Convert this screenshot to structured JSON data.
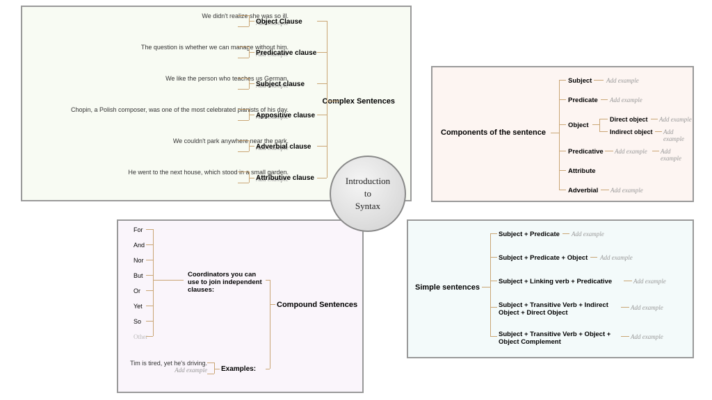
{
  "center": "Introduction\nto\nSyntax",
  "complex": {
    "title": "Complex Sentences",
    "rows": [
      {
        "node": "Object Clause",
        "ex": "We didn't realize she was so ill."
      },
      {
        "node": "Predicative clause",
        "ex": "The question is whether we can manage without him."
      },
      {
        "node": "Subject clause",
        "ex": "We like the person who teaches us German."
      },
      {
        "node": "Appositive clause",
        "ex": "Chopin, a Polish composer, was one of the most celebrated pianists of his day."
      },
      {
        "node": "Adverbial clause",
        "ex": "We couldn't park anywhere near the park."
      },
      {
        "node": "Attributive clause",
        "ex": "He went to the next house, which stood in a small garden."
      }
    ]
  },
  "compound": {
    "title": "Compound Sentences",
    "coords_label": "Coordinators you can use to join independent clauses:",
    "coords": [
      "For",
      "And",
      "Nor",
      "But",
      "Or",
      "Yet",
      "So",
      "Other"
    ],
    "examples_label": "Examples:",
    "example": "Tim is tired, yet he's driving."
  },
  "components": {
    "title": "Components of the sentence",
    "items": [
      {
        "name": "Subject"
      },
      {
        "name": "Predicate"
      },
      {
        "name": "Object",
        "subs": [
          {
            "name": "Direct object"
          },
          {
            "name": "Indirect object"
          }
        ]
      },
      {
        "name": "Predicative",
        "extra": true
      },
      {
        "name": "Attribute",
        "noadd": true
      },
      {
        "name": "Adverbial"
      }
    ]
  },
  "simple": {
    "title": "Simple sentences",
    "patterns": [
      "Subject + Predicate",
      "Subject + Predicate + Object",
      "Subject + Linking verb + Predicative",
      "Subject + Transitive Verb + Indirect Object + Direct Object",
      "Subject + Transitive Verb + Object + Object Complement"
    ]
  },
  "add": "Add example"
}
